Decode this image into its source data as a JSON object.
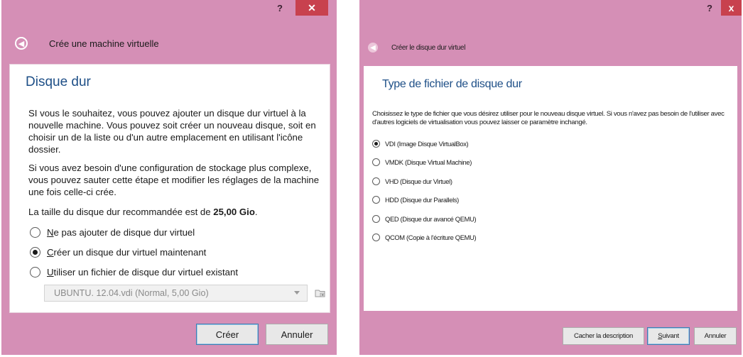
{
  "left_dialog": {
    "help_label": "?",
    "close_label": "✕",
    "title": "Crée une machine virtuelle",
    "back_icon": "back-arrow-icon",
    "section_title": "Disque dur",
    "para1": "SI vous le souhaitez, vous pouvez ajouter un disque dur virtuel à la nouvelle machine. Vous pouvez soit créer un nouveau disque, soit en choisir un de la liste ou d'un autre emplacement en utilisant l'icône dossier.",
    "para2": "Si vous avez besoin d'une configuration de stockage plus complexe, vous pouvez sauter cette étape et modifier les réglages de la machine une fois celle-ci crée.",
    "size_text": "La taille du disque dur recommandée est de ",
    "size_value": "25,00 Gio",
    "size_suffix": ".",
    "options": [
      {
        "mnemonic": "N",
        "rest": "e pas ajouter de disque dur virtuel",
        "checked": false
      },
      {
        "mnemonic": "C",
        "rest": "réer un disque dur virtuel maintenant",
        "checked": true
      },
      {
        "mnemonic": "U",
        "rest": "tiliser un fichier de disque dur virtuel existant",
        "checked": false
      }
    ],
    "existing_disk_value": "UBUNTU. 12.04.vdi (Normal, 5,00 Gio)",
    "create_button": "Créer",
    "cancel_button": "Annuler"
  },
  "right_dialog": {
    "help_label": "?",
    "close_label": "x",
    "title": "Créer le disque dur virtuel",
    "back_icon": "back-arrow-icon",
    "section_title": "Type de fichier de disque dur",
    "description": "Choisissez le type de fichier que vous désirez utiliser pour le nouveau disque virtuel. Si vous n'avez pas besoin de l'utiliser avec d'autres logiciels de virtualisation vous pouvez laisser ce paramètre inchangé.",
    "options": [
      {
        "label": "VDI (Image Disque VirtualBox)",
        "checked": true
      },
      {
        "label": "VMDK (Disque Virtual Machine)",
        "checked": false
      },
      {
        "label": "VHD (Disque dur Virtuel)",
        "checked": false
      },
      {
        "label": "HDD (Disque dur Parallels)",
        "checked": false
      },
      {
        "label": "QED (Disque dur avancé QEMU)",
        "checked": false
      },
      {
        "label": "QCOM (Copie à l'écriture QEMU)",
        "checked": false
      }
    ],
    "hide_description_button": "Cacher la description",
    "next_button_mnemonic": "S",
    "next_button_rest": "uivant",
    "cancel_button": "Annuler"
  },
  "colors": {
    "window_frame": "#d58fb6",
    "close_button": "#c8414e",
    "section_title": "#1e4f87"
  }
}
